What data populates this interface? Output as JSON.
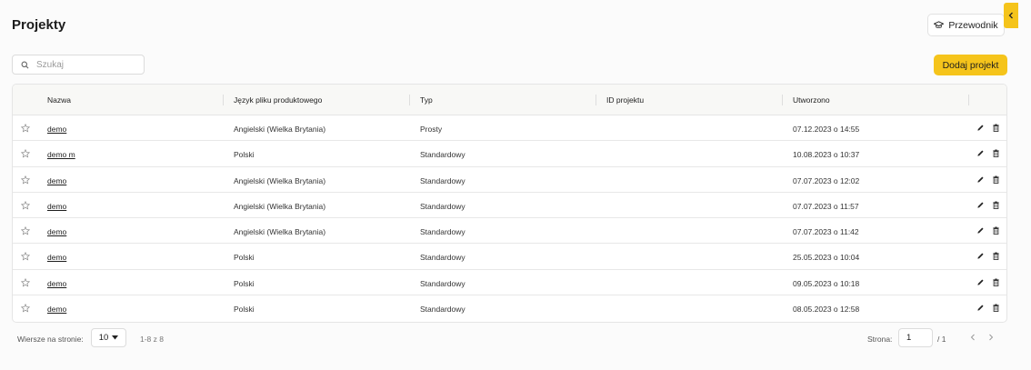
{
  "header": {
    "title": "Projekty",
    "guide_label": "Przewodnik"
  },
  "toolbar": {
    "search_placeholder": "Szukaj",
    "add_label": "Dodaj projekt"
  },
  "table": {
    "columns": [
      "Nazwa",
      "Język pliku produktowego",
      "Typ",
      "ID projektu",
      "Utworzono"
    ],
    "rows": [
      {
        "name": "demo",
        "language": "Angielski (Wielka Brytania)",
        "type": "Prosty",
        "id": "",
        "created": "07.12.2023 o 14:55"
      },
      {
        "name": "demo m",
        "language": "Polski",
        "type": "Standardowy",
        "id": "",
        "created": "10.08.2023 o 10:37"
      },
      {
        "name": "demo",
        "language": "Angielski (Wielka Brytania)",
        "type": "Standardowy",
        "id": "",
        "created": "07.07.2023 o 12:02"
      },
      {
        "name": "demo",
        "language": "Angielski (Wielka Brytania)",
        "type": "Standardowy",
        "id": "",
        "created": "07.07.2023 o 11:57"
      },
      {
        "name": "demo",
        "language": "Angielski (Wielka Brytania)",
        "type": "Standardowy",
        "id": "",
        "created": "07.07.2023 o 11:42"
      },
      {
        "name": "demo",
        "language": "Polski",
        "type": "Standardowy",
        "id": "",
        "created": "25.05.2023 o 10:04"
      },
      {
        "name": "demo",
        "language": "Polski",
        "type": "Standardowy",
        "id": "",
        "created": "09.05.2023 o 10:18"
      },
      {
        "name": "demo",
        "language": "Polski",
        "type": "Standardowy",
        "id": "",
        "created": "08.05.2023 o 12:58"
      }
    ]
  },
  "footer": {
    "rows_per_page_label": "Wiersze na stronie:",
    "rows_per_page_value": "10",
    "range_text": "1-8 z 8",
    "page_label": "Strona:",
    "page_value": "1",
    "page_total": "/ 1"
  },
  "colors": {
    "accent": "#f5c41b",
    "background": "#fbfbfb",
    "header_bg": "#f8f8f6"
  },
  "icons": {
    "guide": "graduation-cap-icon",
    "collapse": "chevron-left-icon",
    "search": "search-icon",
    "favorite": "star-outline-icon",
    "edit": "pencil-icon",
    "delete": "trash-icon",
    "prev": "chevron-left-icon",
    "next": "chevron-right-icon"
  }
}
